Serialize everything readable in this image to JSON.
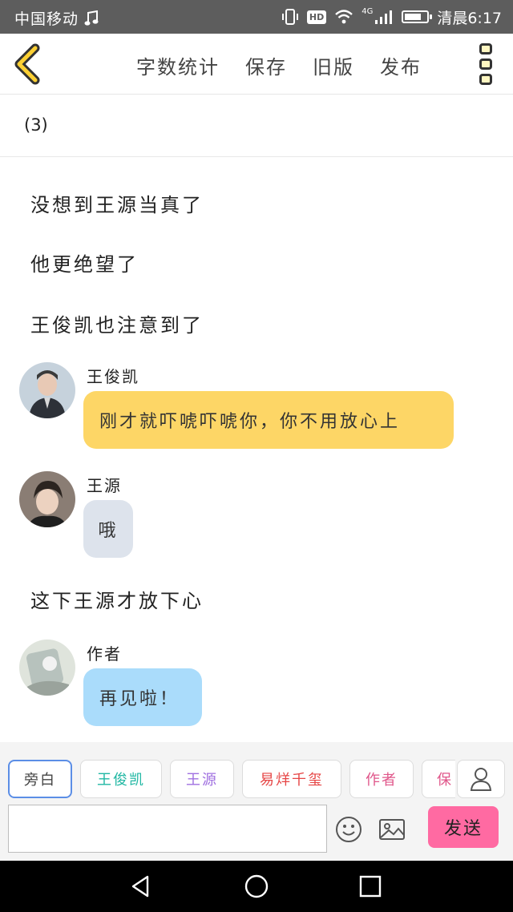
{
  "status_bar": {
    "carrier": "中国移动",
    "hd_badge": "HD",
    "network": "4G",
    "time": "清晨6:17",
    "battery_level": 0.75,
    "icons": [
      "music-note-icon",
      "vibrate-icon",
      "wifi-icon",
      "signal-icon",
      "battery-icon"
    ]
  },
  "toolbar": {
    "back_icon": "chevron-left-icon",
    "actions": [
      "字数统计",
      "保存",
      "旧版",
      "发布"
    ],
    "more_icon": "more-vertical-icon"
  },
  "chapter": {
    "title": "(3)"
  },
  "story": {
    "narration": [
      "没想到王源当真了",
      "他更绝望了",
      "王俊凯也注意到了",
      "这下王源才放下心"
    ],
    "messages": [
      {
        "speaker": "王俊凯",
        "text": "刚才就吓唬吓唬你，你不用放心上",
        "color": "#fdd666"
      },
      {
        "speaker": "王源",
        "text": "哦",
        "color": "#dde3ec"
      },
      {
        "speaker": "作者",
        "text": "再见啦！",
        "color": "#aadcfb"
      }
    ]
  },
  "composer": {
    "roles": [
      {
        "label": "旁白",
        "color": "#444444"
      },
      {
        "label": "王俊凯",
        "color": "#20b7a3"
      },
      {
        "label": "王源",
        "color": "#a070e0"
      },
      {
        "label": "易烊千玺",
        "color": "#e64545"
      },
      {
        "label": "作者",
        "color": "#e0568a"
      },
      {
        "label": "保",
        "color": "#e0568a"
      }
    ],
    "active_role_index": 0,
    "input_value": "",
    "send_label": "发送"
  },
  "theme": {
    "accent": "#fcd033",
    "send_color": "#ff6aa2"
  }
}
